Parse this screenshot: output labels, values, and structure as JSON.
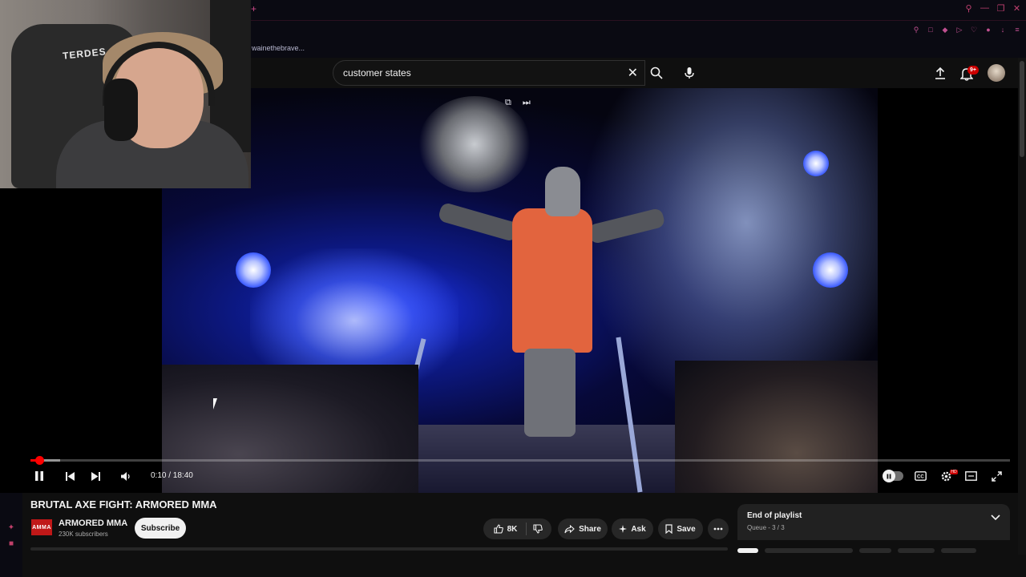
{
  "browser": {
    "new_tab_glyph": "+",
    "url_crumb": "wainethebrave...",
    "accent_color": "#c04070"
  },
  "webcam": {
    "chair_text": "TERDES"
  },
  "search": {
    "query": "customer states",
    "clear_icon": "close-icon",
    "search_icon": "search-icon",
    "mic_icon": "mic-icon"
  },
  "header": {
    "notifications_badge": "9+",
    "upload_icon": "upload-icon",
    "bell_icon": "bell-icon"
  },
  "player": {
    "time_display": "0:10 / 18:40",
    "progress_fraction": 0.009,
    "buffer_fraction": 0.03,
    "progress_color": "#ff0000",
    "hd_badge": "HD"
  },
  "video_info": {
    "title": "BRUTAL AXE FIGHT: ARMORED MMA",
    "channel_logo_text": "AMMA",
    "channel_name": "ARMORED MMA",
    "subscribers": "230K subscribers",
    "subscribe_label": "Subscribe",
    "like_count": "8K",
    "share_label": "Share",
    "ask_label": "Ask",
    "save_label": "Save"
  },
  "playlist": {
    "title": "End of playlist",
    "subtitle": "Queue - 3 / 3"
  }
}
